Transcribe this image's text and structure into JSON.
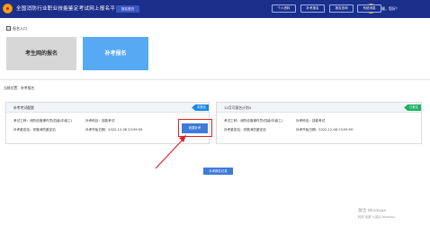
{
  "header": {
    "title": "全国消防行业职业技能鉴定考试网上报名平台",
    "home_label": "报名首页",
    "buttons": [
      "个人资料",
      "补考报名",
      "报名查询",
      "系统消息"
    ],
    "user_name": "刘顺，您好！"
  },
  "entry": {
    "toggle_symbol": "−",
    "label": "报名入口"
  },
  "cards": {
    "candidate_signup": "考生网的报名",
    "makeup_signup": "补考报名"
  },
  "location": "当前位置：补考报名",
  "panels": {
    "left": {
      "title": "补考考试截题",
      "tag": "未报名",
      "line1_a": "考试工种：消防设施操作员(四级/中级工)",
      "line1_b": "补考科目：技能考试",
      "line2_a": "补考鉴定站：安徽消防鉴定站",
      "line2_b": "补考开始日期：2022-12-06 23:59:59",
      "apply_label": "我要补考"
    },
    "right": {
      "title": "12月可报名计划4",
      "tag": "已报名",
      "line1_a": "考试工种：消防设施操作员(四级/中级工)",
      "line1_b": "补考科目：技能考试",
      "line2_a": "补考鉴定站：安徽消防鉴定站",
      "line2_b": "补考开始日期：2022-12-06 23:59:59"
    }
  },
  "record_button": "补考报名记录",
  "watermark": {
    "line1": "激活 Windows",
    "line2": "转到\"设置\"以激活 Windows。"
  },
  "colors": {
    "header_bg": "#1a2f8a",
    "accent_blue": "#3e7bd8",
    "card_blue": "#58a9f3",
    "tag_blue": "#1e88e5",
    "tag_green": "#18b364",
    "highlight_red": "#e02020"
  },
  "icons": {
    "logo": "emblem-icon",
    "avatar": "user-avatar-icon",
    "arrow": "red-pointer-arrow-icon"
  }
}
